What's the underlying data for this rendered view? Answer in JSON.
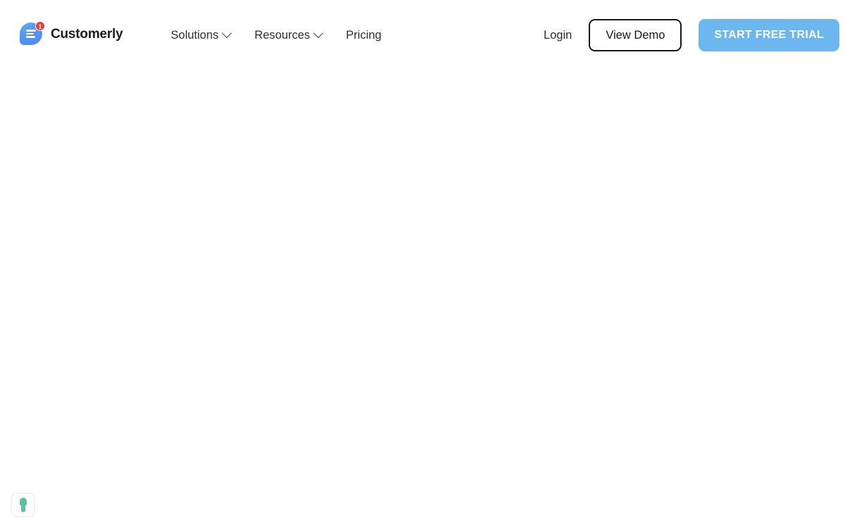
{
  "header": {
    "brand": {
      "name": "Customerly",
      "logo_icon": "chat-bubble-icon",
      "badge_count": "1",
      "badge_color": "#ec3b3b",
      "logo_color": "#4d94f0"
    },
    "nav": [
      {
        "label": "Solutions",
        "icon": "chevron-down-icon",
        "has_dropdown": true
      },
      {
        "label": "Resources",
        "icon": "chevron-down-icon",
        "has_dropdown": true
      },
      {
        "label": "Pricing",
        "has_dropdown": false
      }
    ],
    "actions": {
      "login_label": "Login",
      "demo_label": "View Demo",
      "trial_label": "START FREE TRIAL",
      "trial_color": "#6cb7ef"
    }
  },
  "main": {
    "content": ""
  },
  "widget": {
    "icon": "privacy-shield-icon",
    "icon_color": "#5cc29a"
  }
}
